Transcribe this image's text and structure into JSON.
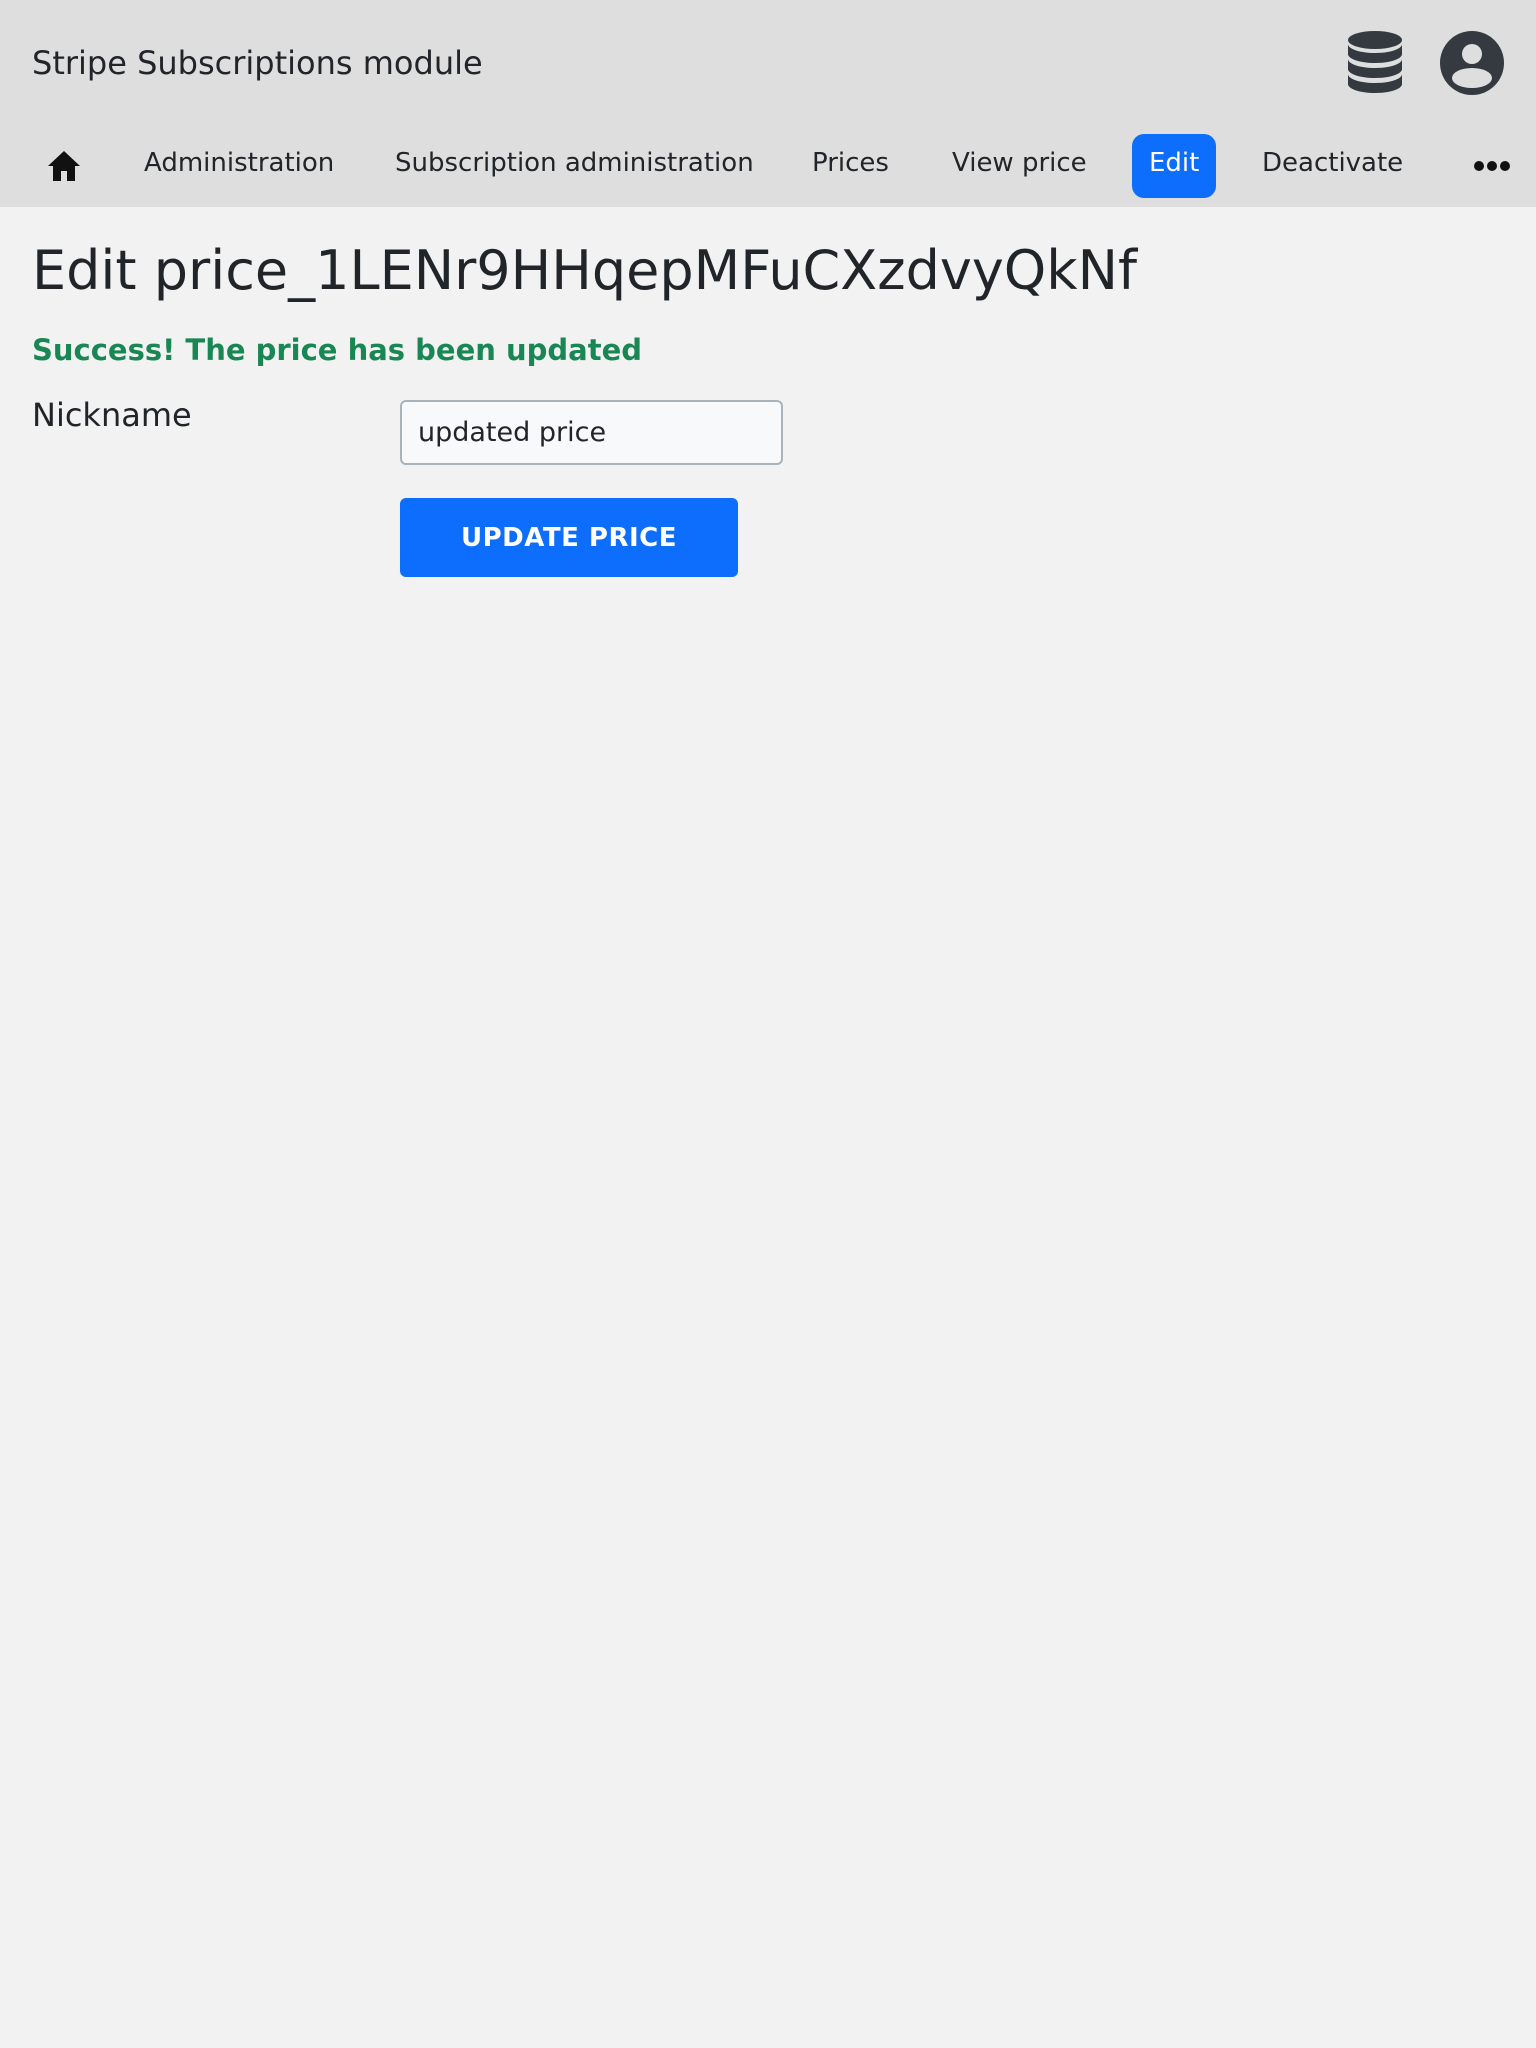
{
  "header": {
    "app_title": "Stripe Subscriptions module",
    "icons": [
      "database-icon",
      "user-account-icon"
    ]
  },
  "nav": {
    "home_icon": "home-icon",
    "items": [
      {
        "label": "Administration",
        "active": false
      },
      {
        "label": "Subscription administration",
        "active": false
      },
      {
        "label": "Prices",
        "active": false
      },
      {
        "label": "View price",
        "active": false
      },
      {
        "label": "Edit",
        "active": true
      },
      {
        "label": "Deactivate",
        "active": false
      }
    ],
    "more_icon": "more-dots-icon"
  },
  "main": {
    "title": "Edit price_1LENr9HHqepMFuCXzdvyQkNf",
    "success_message": "Success! The price has been updated",
    "form": {
      "nickname_label": "Nickname",
      "nickname_value": "updated price",
      "submit_label": "UPDATE PRICE"
    }
  },
  "colors": {
    "primary": "#0d6efd",
    "success": "#198754",
    "topbar_bg": "#dedede",
    "page_bg": "#f2f2f2"
  }
}
